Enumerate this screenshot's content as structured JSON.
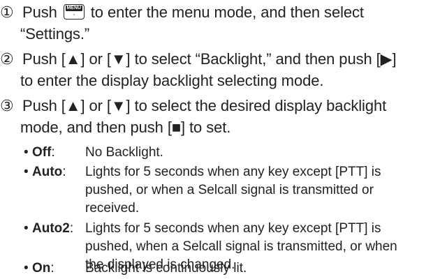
{
  "steps": [
    {
      "number": "①",
      "line1_a": "Push",
      "menu_key_top": "MENU",
      "menu_key_bottom": "◦",
      "line1_b": "to enter the menu mode, and then select",
      "line2": "“Settings.”"
    },
    {
      "number": "②",
      "line1": "Push [▲] or [▼] to select “Backlight,” and then push [▶]",
      "line2": "to enter the display backlight selecting mode."
    },
    {
      "number": "③",
      "line1": "Push [▲] or [▼] to select the desired display backlight",
      "line2": "mode, and then push [■] to set."
    }
  ],
  "options": [
    {
      "term": "Off",
      "lines": [
        "No Backlight."
      ]
    },
    {
      "term": "Auto",
      "lines": [
        "Lights for 5 seconds when any key except [PTT] is",
        "pushed, or when a Selcall signal is transmitted or",
        "received."
      ]
    },
    {
      "term": "Auto2",
      "lines": [
        "Lights for 5 seconds when any key except [PTT] is",
        "pushed, when a Selcall signal is transmitted, or when",
        "the displayed is changed."
      ]
    },
    {
      "term": "On",
      "lines": [
        "Backlight is continuously lit."
      ]
    }
  ],
  "bullet_char": "•",
  "colon": ":"
}
